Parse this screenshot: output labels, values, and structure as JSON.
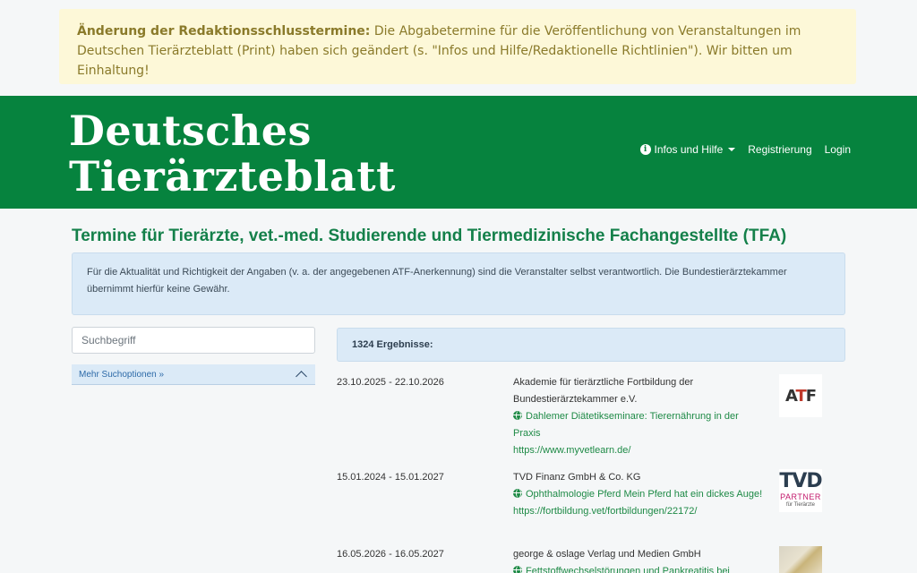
{
  "notice": {
    "heading": "Änderung der Redaktionsschlusstermine:",
    "text": " Die Abgabetermine für die Veröffentlichung von Veranstaltungen im Deutschen Tierärzteblatt (Print) haben sich geändert (s. \"Infos und Hilfe/Redaktionelle Richtlinien\"). Wir bitten um Einhaltung!"
  },
  "header": {
    "logo_line1": "Deutsches",
    "logo_line2": "Tierärzteblatt",
    "nav": {
      "info": "Infos und Hilfe",
      "register": "Registrierung",
      "login": "Login"
    }
  },
  "page": {
    "title": "Termine für Tierärzte, vet.-med. Studierende und Tiermedizinische Fachangestellte (TFA)",
    "disclaimer": "Für die Aktualität und Richtigkeit der Angaben (v. a. der angegebenen ATF-Anerkennung) sind die Veranstalter selbst verantwortlich. Die Bundestierärztekammer übernimmt hierfür keine Gewähr."
  },
  "search": {
    "placeholder": "Suchbegriff",
    "more_options": "Mehr Suchoptionen »"
  },
  "results": {
    "count_label": "1324 Ergebnisse:",
    "items": [
      {
        "date": "23.10.2025 - 22.10.2026",
        "organizer": "Akademie für tierärztliche Fortbildung der Bundestierärztekammer e.V.",
        "title": "Dahlemer Diätetikseminare: Tierernährung in der Praxis",
        "url": "https://www.myvetlearn.de/",
        "logo": "ATF"
      },
      {
        "date": "15.01.2024 - 15.01.2027",
        "organizer": "TVD Finanz GmbH & Co. KG",
        "title": "Ophthalmologie Pferd Mein Pferd hat ein dickes Auge!",
        "url": "https://fortbildung.vet/fortbildungen/22172/",
        "logo": "TVD",
        "logo_partner": "PARTNER",
        "logo_sub": "für Tierärzte"
      },
      {
        "date": "16.05.2026 - 16.05.2027",
        "organizer": "george & oslage Verlag und Medien GmbH",
        "title": "Fettstoffwechselstörungen und Pankreatitis bei",
        "logo": "image"
      }
    ]
  },
  "colors": {
    "brand_green": "#06833e",
    "link_green": "#1e8a46",
    "notice_bg": "#fdf8d8",
    "info_bg": "#dbeaf7"
  }
}
